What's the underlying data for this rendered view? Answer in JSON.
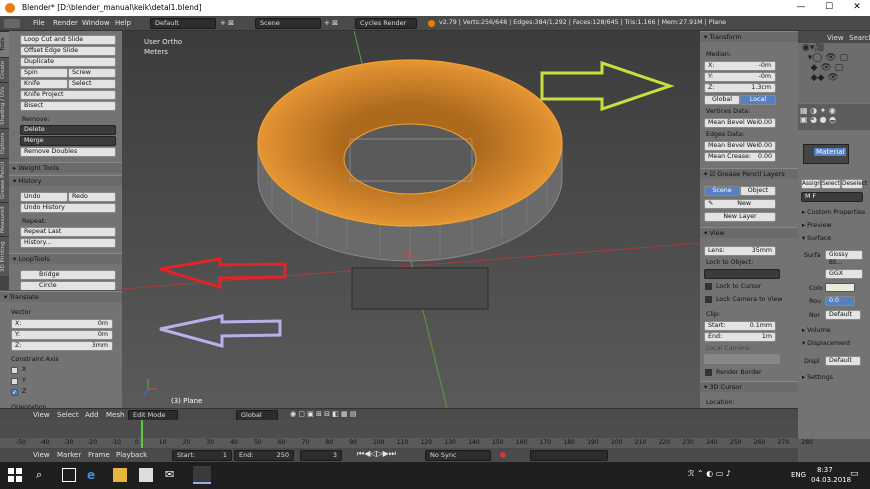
{
  "window": {
    "title": "Blender* [D:\\blender_manual\\keik\\detal1.blend]",
    "minimize": "—",
    "maximize": "☐",
    "close": "✕"
  },
  "info_header": {
    "menus": [
      "File",
      "Render",
      "Window",
      "Help"
    ],
    "layout": "Default",
    "scene": "Scene",
    "engine": "Cycles Render",
    "stats": "v2.79 | Verts:256/648 | Edges:384/1,292 | Faces:128/645 | Tris:1,166 | Mem:27.91M | Plane"
  },
  "tabs": [
    "Tools",
    "Create",
    "Shading / UVs",
    "Options",
    "Grease Pencil",
    "Measureit",
    "3D Printing"
  ],
  "toolshelf": {
    "top_buttons": [
      "Loop Cut and Slide",
      "Offset Edge Slide",
      "Duplicate"
    ],
    "spin": "Spin",
    "screw": "Screw",
    "knife": "Knife",
    "select": "Select",
    "knife_project": "Knife Project",
    "bisect": "Bisect",
    "remove_label": "Remove:",
    "delete": "Delete",
    "merge": "Merge",
    "remove_doubles": "Remove Doubles",
    "weight_tools": "Weight Tools",
    "history": "History",
    "undo": "Undo",
    "redo": "Redo",
    "undo_history": "Undo History",
    "repeat_label": "Repeat:",
    "repeat_last": "Repeat Last",
    "history_btn": "History...",
    "looptools": "LoopTools",
    "bridge": "Bridge",
    "circle": "Circle"
  },
  "translate": {
    "header": "Translate",
    "vector": "Vector",
    "x_label": "X:",
    "x": "0m",
    "y_label": "Y:",
    "y": "0m",
    "z_label": "Z:",
    "z": "3mm",
    "constraint": "Constraint Axis",
    "cx": "X",
    "cy": "Y",
    "cz": "Z",
    "orientation": "Orientation"
  },
  "viewport": {
    "view_name": "User Ortho",
    "units": "Meters",
    "object": "(3) Plane"
  },
  "npanel": {
    "transform": "Transform",
    "median": "Median:",
    "x_label": "X:",
    "x": "-0m",
    "y_label": "Y:",
    "y": "-0m",
    "z_label": "Z:",
    "z": "1.3cm",
    "global": "Global",
    "local": "Local",
    "vertices_data": "Vertices Data:",
    "mean_bevel_w": "Mean Bevel Wei:",
    "mean_bevel_v": "0.00",
    "edges_data": "Edges Data:",
    "edges_bevel_w": "Mean Bevel Wei:",
    "edges_bevel_v": "0.00",
    "mean_crease": "Mean Crease:",
    "mean_crease_v": "0.00",
    "gp_layers": "Grease Pencil Layers",
    "scene_btn": "Scene",
    "object_btn": "Object",
    "new": "New",
    "new_layer": "New Layer",
    "view": "View",
    "lens": "Lens:",
    "lens_v": "35mm",
    "lock_object": "Lock to Object:",
    "lock_cursor": "Lock to Cursor",
    "lock_camera": "Lock Camera to View",
    "clip": "Clip:",
    "start": "Start:",
    "start_v": "0.1mm",
    "end": "End:",
    "end_v": "1m",
    "local_camera": "Local Camera:",
    "render_border": "Render Border",
    "cursor_3d": "3D Cursor",
    "location": "Location:"
  },
  "outliner": {
    "view": "View",
    "search": "Search"
  },
  "properties": {
    "material": "Material",
    "assign": "Assign",
    "select": "Select",
    "deselect": "Deselect",
    "m": "M",
    "f": "F",
    "custom_props": "Custom Properties",
    "preview": "Preview",
    "surface": "Surface",
    "surface_label": "Surfa",
    "surface_val": "Glossy BS...",
    "ggx": "GGX",
    "color": "Colo",
    "roughness": "Rou",
    "rough_v": "0.0",
    "normal": "Nor",
    "normal_v": "Default",
    "volume": "Volume",
    "displacement": "Displacement",
    "displ": "Displ",
    "displ_v": "Default",
    "settings": "Settings"
  },
  "view3d_header": {
    "view": "View",
    "select": "Select",
    "add": "Add",
    "mesh": "Mesh",
    "mode": "Edit Mode",
    "orientation": "Global"
  },
  "timeline": {
    "ticks": [
      "-50",
      "-40",
      "-30",
      "-20",
      "-10",
      "0",
      "10",
      "20",
      "30",
      "40",
      "50",
      "60",
      "70",
      "80",
      "90",
      "100",
      "110",
      "120",
      "130",
      "140",
      "150",
      "160",
      "170",
      "180",
      "190",
      "200",
      "210",
      "220",
      "230",
      "240",
      "250",
      "260",
      "270",
      "280"
    ]
  },
  "timeline_header": {
    "view": "View",
    "marker": "Marker",
    "frame": "Frame",
    "playback": "Playback",
    "start_label": "Start:",
    "start": "1",
    "end_label": "End:",
    "end": "250",
    "current": "3",
    "sync": "No Sync"
  },
  "taskbar": {
    "lang": "ENG",
    "time": "8:37",
    "date": "04.03.2018"
  },
  "colors": {
    "selection_orange": "#f5a22d",
    "arrow_green": "#c8e03c",
    "arrow_red": "#e0242a",
    "arrow_lavender": "#b8b0e8",
    "local_blue": "#5680c2"
  }
}
